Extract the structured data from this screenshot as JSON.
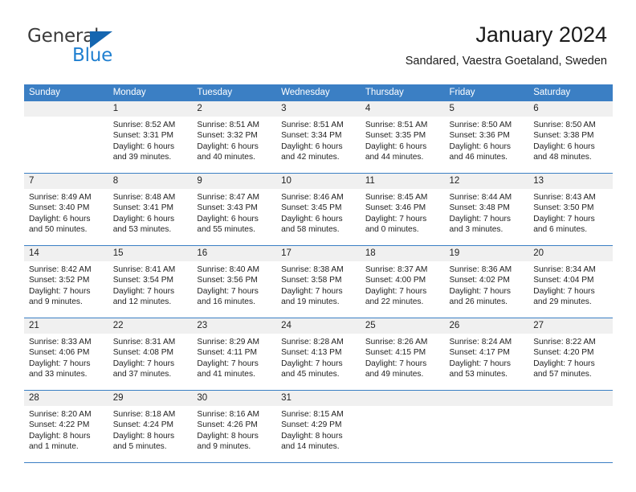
{
  "brand": {
    "name_part1": "General",
    "name_part2": "Blue",
    "accent_color": "#1f7fd0",
    "triangle_color": "#1566b0"
  },
  "header": {
    "title": "January 2024",
    "subtitle": "Sandared, Vaestra Goetaland, Sweden"
  },
  "calendar": {
    "header_bg": "#3b7fc4",
    "daynum_bg": "#f0f0f0",
    "weekdays": [
      "Sunday",
      "Monday",
      "Tuesday",
      "Wednesday",
      "Thursday",
      "Friday",
      "Saturday"
    ],
    "weeks": [
      [
        {
          "day": "",
          "lines": []
        },
        {
          "day": "1",
          "lines": [
            "Sunrise: 8:52 AM",
            "Sunset: 3:31 PM",
            "Daylight: 6 hours",
            "and 39 minutes."
          ]
        },
        {
          "day": "2",
          "lines": [
            "Sunrise: 8:51 AM",
            "Sunset: 3:32 PM",
            "Daylight: 6 hours",
            "and 40 minutes."
          ]
        },
        {
          "day": "3",
          "lines": [
            "Sunrise: 8:51 AM",
            "Sunset: 3:34 PM",
            "Daylight: 6 hours",
            "and 42 minutes."
          ]
        },
        {
          "day": "4",
          "lines": [
            "Sunrise: 8:51 AM",
            "Sunset: 3:35 PM",
            "Daylight: 6 hours",
            "and 44 minutes."
          ]
        },
        {
          "day": "5",
          "lines": [
            "Sunrise: 8:50 AM",
            "Sunset: 3:36 PM",
            "Daylight: 6 hours",
            "and 46 minutes."
          ]
        },
        {
          "day": "6",
          "lines": [
            "Sunrise: 8:50 AM",
            "Sunset: 3:38 PM",
            "Daylight: 6 hours",
            "and 48 minutes."
          ]
        }
      ],
      [
        {
          "day": "7",
          "lines": [
            "Sunrise: 8:49 AM",
            "Sunset: 3:40 PM",
            "Daylight: 6 hours",
            "and 50 minutes."
          ]
        },
        {
          "day": "8",
          "lines": [
            "Sunrise: 8:48 AM",
            "Sunset: 3:41 PM",
            "Daylight: 6 hours",
            "and 53 minutes."
          ]
        },
        {
          "day": "9",
          "lines": [
            "Sunrise: 8:47 AM",
            "Sunset: 3:43 PM",
            "Daylight: 6 hours",
            "and 55 minutes."
          ]
        },
        {
          "day": "10",
          "lines": [
            "Sunrise: 8:46 AM",
            "Sunset: 3:45 PM",
            "Daylight: 6 hours",
            "and 58 minutes."
          ]
        },
        {
          "day": "11",
          "lines": [
            "Sunrise: 8:45 AM",
            "Sunset: 3:46 PM",
            "Daylight: 7 hours",
            "and 0 minutes."
          ]
        },
        {
          "day": "12",
          "lines": [
            "Sunrise: 8:44 AM",
            "Sunset: 3:48 PM",
            "Daylight: 7 hours",
            "and 3 minutes."
          ]
        },
        {
          "day": "13",
          "lines": [
            "Sunrise: 8:43 AM",
            "Sunset: 3:50 PM",
            "Daylight: 7 hours",
            "and 6 minutes."
          ]
        }
      ],
      [
        {
          "day": "14",
          "lines": [
            "Sunrise: 8:42 AM",
            "Sunset: 3:52 PM",
            "Daylight: 7 hours",
            "and 9 minutes."
          ]
        },
        {
          "day": "15",
          "lines": [
            "Sunrise: 8:41 AM",
            "Sunset: 3:54 PM",
            "Daylight: 7 hours",
            "and 12 minutes."
          ]
        },
        {
          "day": "16",
          "lines": [
            "Sunrise: 8:40 AM",
            "Sunset: 3:56 PM",
            "Daylight: 7 hours",
            "and 16 minutes."
          ]
        },
        {
          "day": "17",
          "lines": [
            "Sunrise: 8:38 AM",
            "Sunset: 3:58 PM",
            "Daylight: 7 hours",
            "and 19 minutes."
          ]
        },
        {
          "day": "18",
          "lines": [
            "Sunrise: 8:37 AM",
            "Sunset: 4:00 PM",
            "Daylight: 7 hours",
            "and 22 minutes."
          ]
        },
        {
          "day": "19",
          "lines": [
            "Sunrise: 8:36 AM",
            "Sunset: 4:02 PM",
            "Daylight: 7 hours",
            "and 26 minutes."
          ]
        },
        {
          "day": "20",
          "lines": [
            "Sunrise: 8:34 AM",
            "Sunset: 4:04 PM",
            "Daylight: 7 hours",
            "and 29 minutes."
          ]
        }
      ],
      [
        {
          "day": "21",
          "lines": [
            "Sunrise: 8:33 AM",
            "Sunset: 4:06 PM",
            "Daylight: 7 hours",
            "and 33 minutes."
          ]
        },
        {
          "day": "22",
          "lines": [
            "Sunrise: 8:31 AM",
            "Sunset: 4:08 PM",
            "Daylight: 7 hours",
            "and 37 minutes."
          ]
        },
        {
          "day": "23",
          "lines": [
            "Sunrise: 8:29 AM",
            "Sunset: 4:11 PM",
            "Daylight: 7 hours",
            "and 41 minutes."
          ]
        },
        {
          "day": "24",
          "lines": [
            "Sunrise: 8:28 AM",
            "Sunset: 4:13 PM",
            "Daylight: 7 hours",
            "and 45 minutes."
          ]
        },
        {
          "day": "25",
          "lines": [
            "Sunrise: 8:26 AM",
            "Sunset: 4:15 PM",
            "Daylight: 7 hours",
            "and 49 minutes."
          ]
        },
        {
          "day": "26",
          "lines": [
            "Sunrise: 8:24 AM",
            "Sunset: 4:17 PM",
            "Daylight: 7 hours",
            "and 53 minutes."
          ]
        },
        {
          "day": "27",
          "lines": [
            "Sunrise: 8:22 AM",
            "Sunset: 4:20 PM",
            "Daylight: 7 hours",
            "and 57 minutes."
          ]
        }
      ],
      [
        {
          "day": "28",
          "lines": [
            "Sunrise: 8:20 AM",
            "Sunset: 4:22 PM",
            "Daylight: 8 hours",
            "and 1 minute."
          ]
        },
        {
          "day": "29",
          "lines": [
            "Sunrise: 8:18 AM",
            "Sunset: 4:24 PM",
            "Daylight: 8 hours",
            "and 5 minutes."
          ]
        },
        {
          "day": "30",
          "lines": [
            "Sunrise: 8:16 AM",
            "Sunset: 4:26 PM",
            "Daylight: 8 hours",
            "and 9 minutes."
          ]
        },
        {
          "day": "31",
          "lines": [
            "Sunrise: 8:15 AM",
            "Sunset: 4:29 PM",
            "Daylight: 8 hours",
            "and 14 minutes."
          ]
        },
        {
          "day": "",
          "lines": []
        },
        {
          "day": "",
          "lines": []
        },
        {
          "day": "",
          "lines": []
        }
      ]
    ]
  }
}
